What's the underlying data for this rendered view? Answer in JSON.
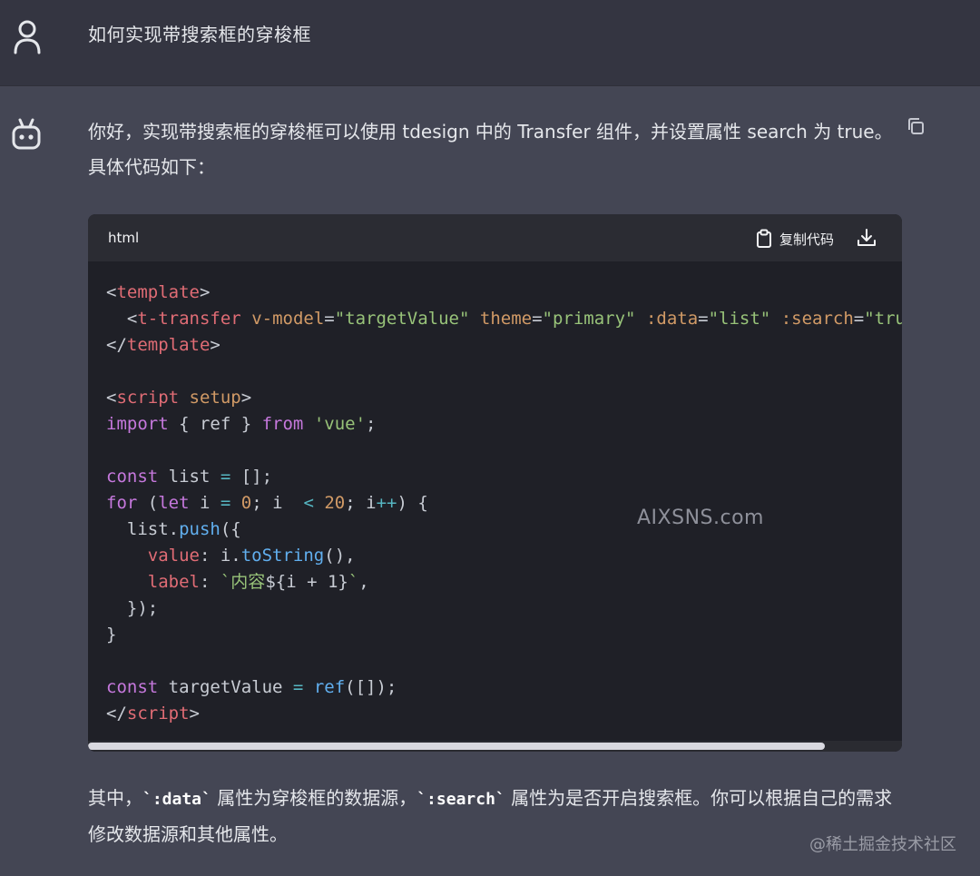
{
  "user_message": "如何实现带搜索框的穿梭框",
  "assistant": {
    "intro": "你好，实现带搜索框的穿梭框可以使用 tdesign 中的 Transfer 组件，并设置属性 search 为 true。具体代码如下：",
    "code_block": {
      "language": "html",
      "copy_label": "复制代码"
    },
    "outro": {
      "part1": "其中，",
      "code1": "`:data`",
      "part2": " 属性为穿梭框的数据源，",
      "code2": "`:search`",
      "part3": " 属性为是否开启搜索框。你可以根据自己的需求修改数据源和其他属性。"
    }
  },
  "code_lines": {
    "l1": {
      "t1": "<",
      "t2": "template",
      "t3": ">"
    },
    "l2": {
      "indent": "  ",
      "t1": "<",
      "t2": "t-transfer",
      "a1": "v-model",
      "eq1": "=",
      "v1": "\"targetValue\"",
      "a2": "theme",
      "eq2": "=",
      "v2": "\"primary\"",
      "a3": ":data",
      "eq3": "=",
      "v3": "\"list\"",
      "a4": ":search",
      "eq4": "=",
      "v4": "\"true\""
    },
    "l3": {
      "t1": "</",
      "t2": "template",
      "t3": ">"
    },
    "l5": {
      "t1": "<",
      "t2": "script",
      "a1": "setup",
      "t3": ">"
    },
    "l6": {
      "k1": "import",
      "p1": " { ref } ",
      "k2": "from",
      "s1": "'vue'",
      "p2": ";"
    },
    "l8": {
      "k1": "const",
      "p1": " list ",
      "o1": "=",
      "p2": " [];"
    },
    "l9": {
      "k1": "for",
      "p1": " (",
      "k2": "let",
      "p2": " i ",
      "o1": "=",
      "n1": "0",
      "p3": "; i ",
      "o2": "<",
      "n2": "20",
      "p4": "; i",
      "o3": "++",
      "p5": ") {"
    },
    "l10": {
      "p1": "  list.",
      "f1": "push",
      "p2": "({"
    },
    "l11": {
      "indent": "    ",
      "pr1": "value",
      "p1": ": i.",
      "f1": "toString",
      "p2": "(),"
    },
    "l12": {
      "indent": "    ",
      "pr1": "label",
      "p1": ": ",
      "s1": "`内容",
      "p2": "${i + 1}",
      "s2": "`",
      "p3": ","
    },
    "l13": {
      "p1": "  });"
    },
    "l14": {
      "p1": "}"
    },
    "l16": {
      "k1": "const",
      "p1": " targetValue ",
      "o1": "=",
      "f1": " ref",
      "p2": "([]);"
    },
    "l17": {
      "t1": "</",
      "t2": "script",
      "t3": ">"
    }
  },
  "watermarks": {
    "center": "AIXSNS.com",
    "corner": "@稀土掘金技术社区"
  },
  "icons": {
    "user_avatar": "user-icon",
    "bot_avatar": "robot-icon",
    "copy_message": "copy-icon",
    "copy_code": "clipboard-icon",
    "download": "download-icon"
  }
}
